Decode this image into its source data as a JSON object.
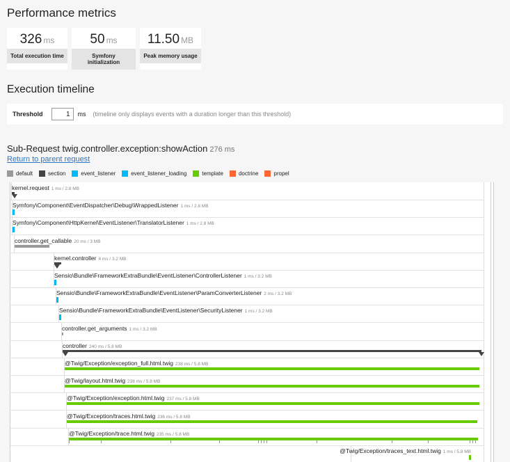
{
  "perf": {
    "title": "Performance metrics",
    "metrics": [
      {
        "value": "326",
        "unit": "ms",
        "label": "Total execution time"
      },
      {
        "value": "50",
        "unit": "ms",
        "label": "Symfony initialization"
      },
      {
        "value": "11.50",
        "unit": "MB",
        "label": "Peak memory usage"
      }
    ]
  },
  "timeline": {
    "title": "Execution timeline",
    "threshold_label": "Threshold",
    "threshold_value": "1",
    "threshold_unit": "ms",
    "threshold_note": "(timeline only displays events with a duration longer than this threshold)"
  },
  "subrequest": {
    "title": "Sub-Request twig.controller.exception:showAction",
    "duration": "276 ms",
    "return_link": "Return to parent request"
  },
  "legend": [
    {
      "label": "default",
      "color": "#999999"
    },
    {
      "label": "section",
      "color": "#444444"
    },
    {
      "label": "event_listener",
      "color": "#00b8f5"
    },
    {
      "label": "event_listener_loading",
      "color": "#00b8f5"
    },
    {
      "label": "template",
      "color": "#66cc00"
    },
    {
      "label": "doctrine",
      "color": "#ff6633"
    },
    {
      "label": "propel",
      "color": "#ff6633"
    }
  ],
  "events": [
    {
      "name": "kernel.request",
      "meta": "1 ms / 2.8 MB"
    },
    {
      "name": "Symfony\\Component\\EventDispatcher\\Debug\\WrappedListener",
      "meta": "1 ms / 2.8 MB"
    },
    {
      "name": "Symfony\\Component\\HttpKernel\\EventListener\\TranslatorListener",
      "meta": "1 ms / 2.8 MB"
    },
    {
      "name": "controller.get_callable",
      "meta": "20 ms / 3 MB"
    },
    {
      "name": "kernel.controller",
      "meta": "4 ms / 3.2 MB"
    },
    {
      "name": "Sensio\\Bundle\\FrameworkExtraBundle\\EventListener\\ControllerListener",
      "meta": "1 ms / 3.2 MB"
    },
    {
      "name": "Sensio\\Bundle\\FrameworkExtraBundle\\EventListener\\ParamConverterListener",
      "meta": "2 ms / 3.2 MB"
    },
    {
      "name": "Sensio\\Bundle\\FrameworkExtraBundle\\EventListener\\SecurityListener",
      "meta": "1 ms / 3.2 MB"
    },
    {
      "name": "controller.get_arguments",
      "meta": "1 ms / 3.2 MB"
    },
    {
      "name": "controller",
      "meta": "240 ms / 5.8 MB"
    },
    {
      "name": "@Twig/Exception/exception_full.html.twig",
      "meta": "238 ms / 5.8 MB"
    },
    {
      "name": "@Twig/layout.html.twig",
      "meta": "238 ms / 5.8 MB"
    },
    {
      "name": "@Twig/Exception/exception.html.twig",
      "meta": "237 ms / 5.8 MB"
    },
    {
      "name": "@Twig/Exception/traces.html.twig",
      "meta": "236 ms / 5.8 MB"
    },
    {
      "name": "@Twig/Exception/trace.html.twig",
      "meta": "235 ms / 5.8 MB"
    },
    {
      "name": "@Twig/Exception/traces_text.html.twig",
      "meta": "1 ms / 5.8 MB"
    }
  ]
}
